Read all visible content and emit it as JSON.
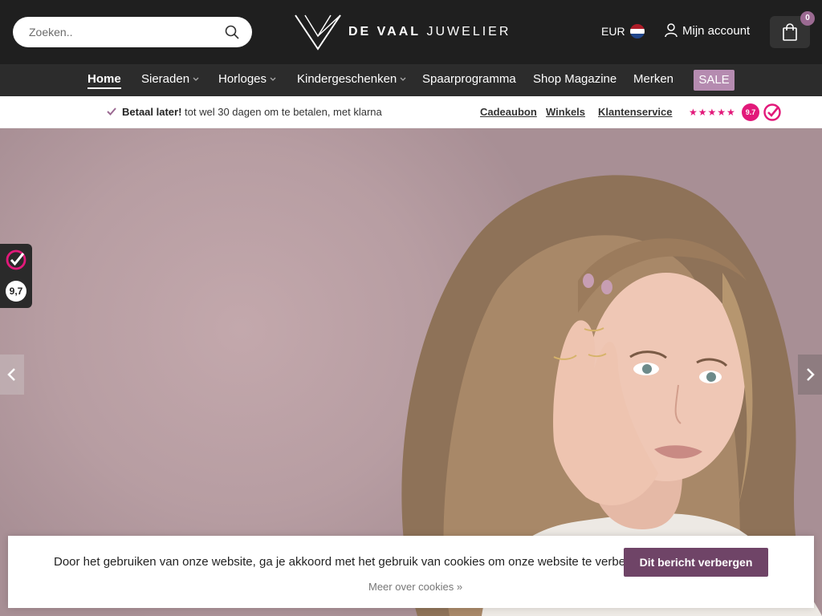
{
  "header": {
    "search_placeholder": "Zoeken..",
    "logo_bold": "DE VAAL",
    "logo_light": "JUWELIER",
    "currency": "EUR",
    "account_label": "Mijn account",
    "cart_count": "0"
  },
  "nav": {
    "items": [
      {
        "label": "Home"
      },
      {
        "label": "Sieraden"
      },
      {
        "label": "Horloges"
      },
      {
        "label": "Kindergeschenken"
      },
      {
        "label": "Spaarprogramma"
      },
      {
        "label": "Shop Magazine"
      },
      {
        "label": "Merken"
      }
    ],
    "sale_label": "SALE"
  },
  "usp": {
    "bold": "Betaal later!",
    "text": "tot wel 30 dagen om te betalen, met klarna",
    "links": [
      "Cadeaubon",
      "Winkels",
      "Klantenservice"
    ],
    "stars": "★★★★★",
    "score": "9.7"
  },
  "side_badge": {
    "score": "9,7"
  },
  "cookie": {
    "text": "Door het gebruiken van onze website, ga je akkoord met het gebruik van cookies om onze website te verbeteren.",
    "button": "Dit bericht verbergen",
    "more": "Meer over cookies »"
  },
  "colors": {
    "header_bg": "#1f1f1f",
    "nav_bg": "#2c2c2c",
    "accent": "#6f4467",
    "sale": "#b58bb0",
    "kiyoh_pink": "#e2197a"
  }
}
